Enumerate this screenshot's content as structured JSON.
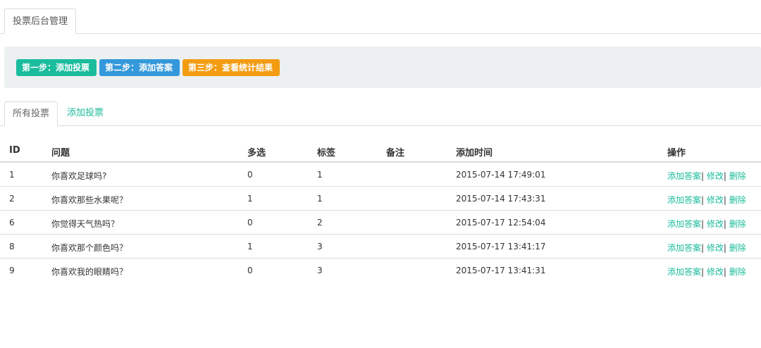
{
  "header": {
    "tab_label": "投票后台管理"
  },
  "steps": [
    {
      "label": "第一步：添加投票",
      "color": "#1abc9c"
    },
    {
      "label": "第二步：添加答案",
      "color": "#3498db"
    },
    {
      "label": "第三步：查看统计结果",
      "color": "#f39c12"
    }
  ],
  "tabs": {
    "active": "所有投票",
    "add": "添加投票"
  },
  "table": {
    "headers": {
      "id": "ID",
      "question": "问题",
      "multi": "多选",
      "tag": "标签",
      "note": "备注",
      "time": "添加时间",
      "ops": "操作"
    },
    "ops": {
      "add_answer": "添加答案",
      "sep": "|",
      "edit": "修改",
      "delete": "删除"
    },
    "rows": [
      {
        "id": "1",
        "question": "你喜欢足球吗?",
        "multi": "0",
        "tag": "1",
        "note": "",
        "time": "2015-07-14 17:49:01"
      },
      {
        "id": "2",
        "question": "你喜欢那些水果呢？",
        "multi": "1",
        "tag": "1",
        "note": "",
        "time": "2015-07-14 17:43:31"
      },
      {
        "id": "6",
        "question": "你觉得天气热吗？",
        "multi": "0",
        "tag": "2",
        "note": "",
        "time": "2015-07-17 12:54:04"
      },
      {
        "id": "8",
        "question": "你喜欢那个颜色吗？",
        "multi": "1",
        "tag": "3",
        "note": "",
        "time": "2015-07-17 13:41:17"
      },
      {
        "id": "9",
        "question": "你喜欢我的眼睛吗？",
        "multi": "0",
        "tag": "3",
        "note": "",
        "time": "2015-07-17 13:41:31"
      }
    ]
  }
}
